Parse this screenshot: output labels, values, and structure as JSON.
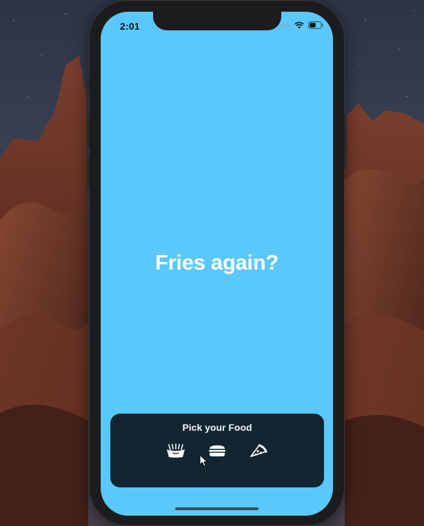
{
  "status_bar": {
    "time": "2:01",
    "icons": [
      "signal-dots-icon",
      "wifi-icon",
      "battery-icon"
    ]
  },
  "main": {
    "headline": "Fries again?"
  },
  "food_picker": {
    "title": "Pick your Food",
    "options": [
      {
        "icon": "fries-icon",
        "selected": true
      },
      {
        "icon": "burger-icon",
        "selected": false
      },
      {
        "icon": "pizza-icon",
        "selected": false
      }
    ]
  },
  "colors": {
    "screen_background": "#5ac8fa",
    "panel_background": "#122631",
    "headline_text": "#ffffff"
  }
}
